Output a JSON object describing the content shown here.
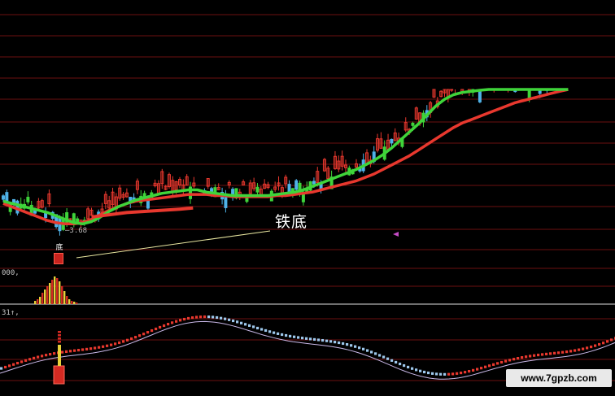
{
  "chart_data": [
    {
      "type": "line",
      "title": "",
      "panel": "price",
      "annotations": {
        "pattern_label": "铁底",
        "low_value": "3.68",
        "bottom_marker": "底"
      },
      "series": [
        {
          "name": "",
          "color": "#e8382e",
          "x": [
            0,
            10,
            20,
            30,
            40,
            50,
            60,
            70,
            80,
            90,
            100,
            110,
            120,
            130,
            140,
            150,
            160,
            170,
            180,
            190,
            200,
            210,
            220,
            230,
            240,
            250,
            260,
            270,
            280,
            290,
            300,
            310,
            320,
            330,
            340,
            350,
            360,
            370,
            380,
            390,
            400,
            410,
            420,
            430,
            440,
            450,
            460,
            470,
            480,
            490,
            500,
            510,
            520,
            530,
            540,
            550,
            560,
            570,
            580,
            590,
            600,
            610,
            620,
            630,
            640
          ],
          "values": [
            3.9,
            3.87,
            3.84,
            3.81,
            3.78,
            3.75,
            3.73,
            3.72,
            3.72,
            3.73,
            3.76,
            3.8,
            3.84,
            3.87,
            3.9,
            3.92,
            3.93,
            3.94,
            3.95,
            3.96,
            3.97,
            3.98,
            3.98,
            3.98,
            3.97,
            3.97,
            3.96,
            3.96,
            3.96,
            3.96,
            3.96,
            3.97,
            3.97,
            3.98,
            3.99,
            4.0,
            4.02,
            4.04,
            4.06,
            4.08,
            4.1,
            4.13,
            4.16,
            4.2,
            4.24,
            4.28,
            4.32,
            4.37,
            4.42,
            4.47,
            4.52,
            4.57,
            4.61,
            4.64,
            4.67,
            4.7,
            4.73,
            4.76,
            4.79,
            4.81,
            4.83,
            4.85,
            4.87,
            4.89,
            4.91
          ]
        },
        {
          "name": "",
          "color": "#3fd43a",
          "x": [
            0,
            10,
            20,
            30,
            40,
            50,
            60,
            70,
            80,
            90,
            100,
            110,
            120,
            130,
            140,
            150,
            160,
            170,
            180,
            190,
            200,
            210,
            220,
            230,
            240,
            250,
            260,
            270,
            280,
            290,
            300,
            310,
            320,
            330,
            340,
            350,
            360,
            370,
            380,
            390,
            400,
            410,
            420,
            430,
            440,
            450,
            460,
            470,
            480,
            490,
            500,
            510,
            520,
            530,
            540,
            550,
            560,
            570,
            580,
            590,
            600,
            610,
            620,
            630,
            640
          ],
          "values": [
            3.92,
            3.9,
            3.88,
            3.86,
            3.84,
            3.82,
            3.79,
            3.76,
            3.73,
            3.72,
            3.74,
            3.78,
            3.83,
            3.87,
            3.9,
            3.93,
            3.95,
            3.97,
            3.99,
            4.0,
            4.01,
            4.02,
            4.02,
            4.0,
            3.99,
            3.98,
            3.97,
            3.97,
            3.97,
            3.97,
            3.97,
            3.98,
            3.99,
            4.0,
            4.02,
            4.05,
            4.08,
            4.11,
            4.14,
            4.17,
            4.2,
            4.24,
            4.28,
            4.33,
            4.39,
            4.46,
            4.53,
            4.6,
            4.68,
            4.76,
            4.82,
            4.86,
            4.88,
            4.89,
            4.9,
            4.91,
            4.92,
            4.92,
            4.93,
            4.94,
            4.95,
            4.96,
            4.97,
            4.98,
            5.0
          ]
        },
        {
          "name": "",
          "color": "#e8382e",
          "x": [
            100,
            120,
            140,
            160,
            180,
            200,
            215
          ],
          "values": [
            3.78,
            3.8,
            3.82,
            3.83,
            3.84,
            3.85,
            3.86
          ]
        }
      ]
    },
    {
      "type": "bar",
      "panel": "volume",
      "pane_label": "000,"
    },
    {
      "type": "line",
      "panel": "oscillator",
      "pane_label": "31↑,"
    }
  ],
  "watermark": "www.7gpzb.com"
}
